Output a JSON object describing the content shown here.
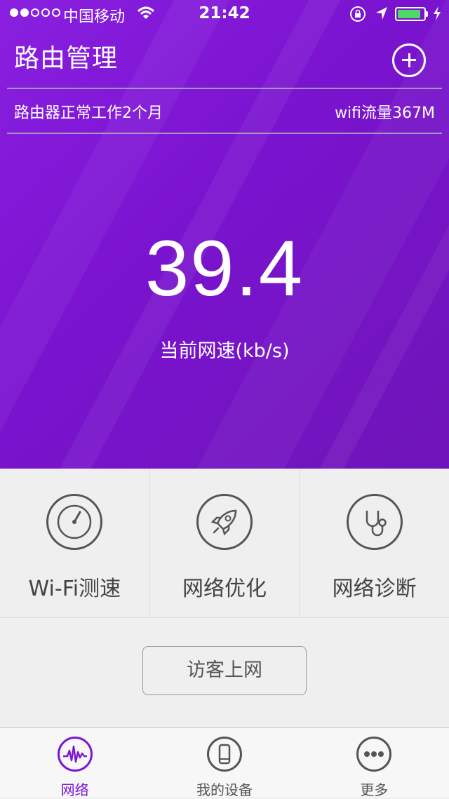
{
  "status_bar": {
    "carrier": "中国移动",
    "time": "21:42",
    "signal_dots_filled": 2,
    "signal_dots_total": 5,
    "battery_level": 0.9,
    "icons": [
      "wifi-icon",
      "orientation-lock-icon",
      "location-arrow-icon",
      "battery-icon",
      "charging-icon"
    ]
  },
  "header": {
    "title": "路由管理",
    "add_icon": "plus-circle-icon"
  },
  "info": {
    "uptime": "路由器正常工作2个月",
    "traffic": "wifi流量367M"
  },
  "speed": {
    "value": "39.4",
    "label": "当前网速(kb/s)"
  },
  "features": [
    {
      "label": "Wi-Fi测速",
      "icon": "speedometer-icon"
    },
    {
      "label": "网络优化",
      "icon": "rocket-icon"
    },
    {
      "label": "网络诊断",
      "icon": "stethoscope-icon"
    }
  ],
  "guest_button": "访客上网",
  "tabs": [
    {
      "label": "网络",
      "icon": "pulse-icon",
      "active": true
    },
    {
      "label": "我的设备",
      "icon": "phone-icon",
      "active": false
    },
    {
      "label": "更多",
      "icon": "more-icon",
      "active": false
    }
  ],
  "colors": {
    "brand_purple": "#7b16d3",
    "battery_green": "#4cd964"
  }
}
